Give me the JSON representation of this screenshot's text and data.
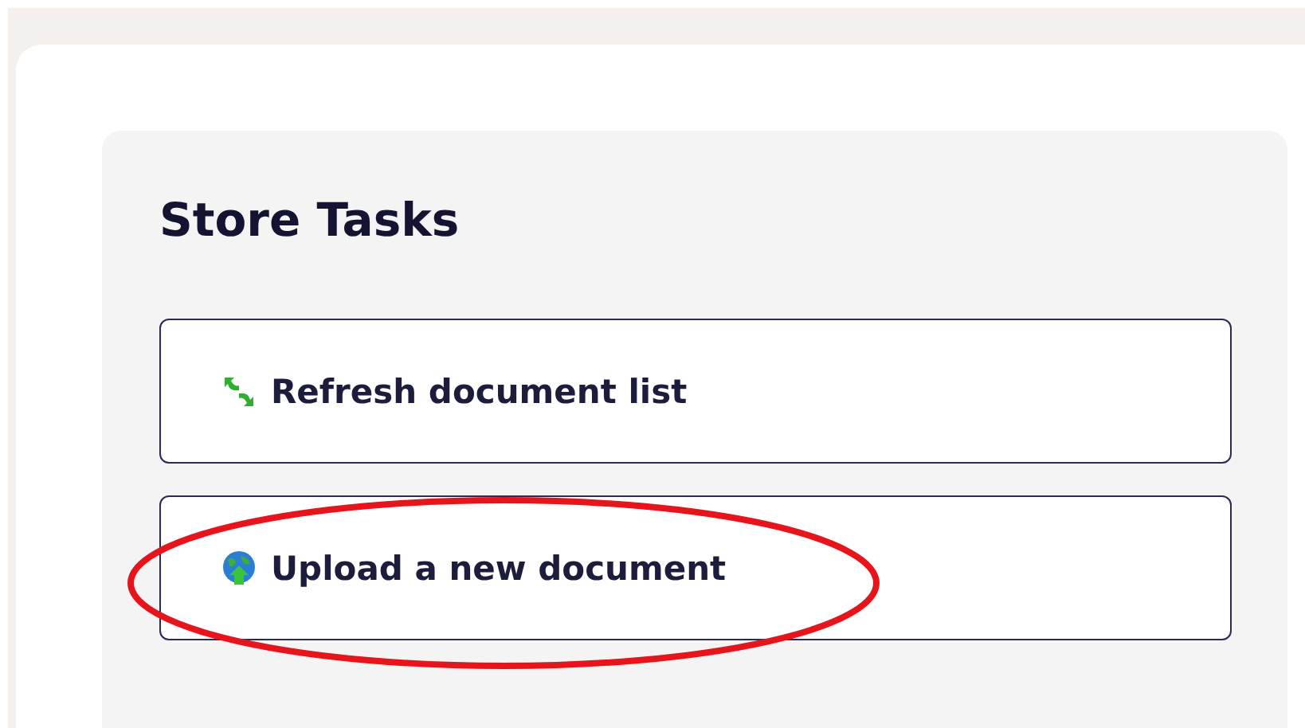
{
  "panel": {
    "title": "Store Tasks"
  },
  "tasks": [
    {
      "kind": "refresh",
      "label": "Refresh document list",
      "highlighted": false
    },
    {
      "kind": "upload",
      "label": "Upload a new document",
      "highlighted": true
    }
  ]
}
